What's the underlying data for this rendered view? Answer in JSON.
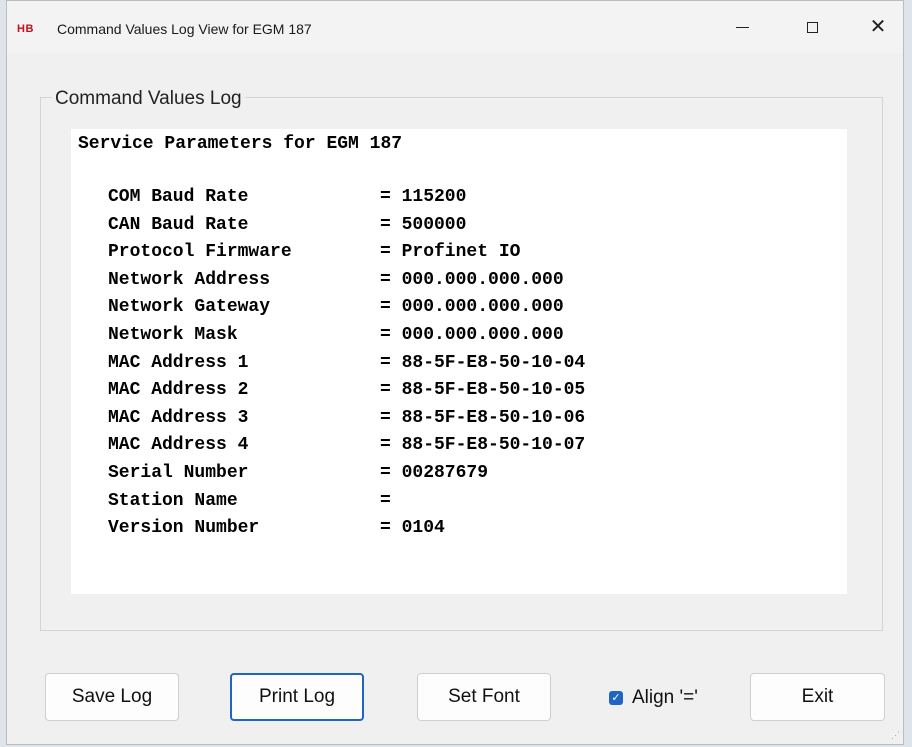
{
  "window": {
    "app_icon": "HB",
    "title": "Command Values Log View for EGM 187",
    "controls": {
      "minimize": "minimize-icon",
      "maximize": "maximize-icon",
      "close": "close-icon"
    }
  },
  "group": {
    "label": "Command Values Log"
  },
  "log": {
    "header": "Service Parameters for EGM 187",
    "rows": [
      {
        "name": "COM Baud Rate",
        "eq": "= 115200"
      },
      {
        "name": "CAN Baud Rate",
        "eq": "= 500000"
      },
      {
        "name": "Protocol Firmware",
        "eq": "= Profinet IO"
      },
      {
        "name": "Network Address",
        "eq": "= 000.000.000.000"
      },
      {
        "name": "Network Gateway",
        "eq": "= 000.000.000.000"
      },
      {
        "name": "Network Mask",
        "eq": "= 000.000.000.000"
      },
      {
        "name": "MAC Address 1",
        "eq": "= 88-5F-E8-50-10-04"
      },
      {
        "name": "MAC Address 2",
        "eq": "= 88-5F-E8-50-10-05"
      },
      {
        "name": "MAC Address 3",
        "eq": "= 88-5F-E8-50-10-06"
      },
      {
        "name": "MAC Address 4",
        "eq": "= 88-5F-E8-50-10-07"
      },
      {
        "name": "Serial Number",
        "eq": "= 00287679"
      },
      {
        "name": "Station Name",
        "eq": "="
      },
      {
        "name": "Version Number",
        "eq": "= 0104"
      }
    ]
  },
  "buttons": {
    "save": "Save Log",
    "print": "Print Log",
    "font": "Set Font",
    "exit": "Exit"
  },
  "align_checkbox": {
    "label": "Align '='",
    "checked": true
  },
  "colors": {
    "accent": "#1f66c4",
    "brand_red": "#c1121f"
  }
}
